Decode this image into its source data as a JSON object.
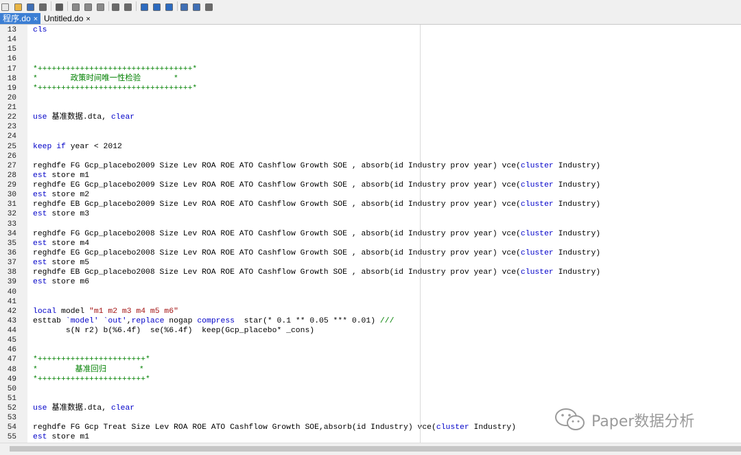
{
  "toolbar": {
    "icons": [
      "new-file-icon",
      "open-file-icon",
      "save-icon",
      "print-icon",
      "find-icon",
      "cut-icon",
      "copy-icon",
      "paste-icon",
      "undo-icon",
      "redo-icon",
      "indent-icon",
      "bookmark-up-icon",
      "bookmark-down-icon",
      "execute-icon",
      "run-icon",
      "more-icon"
    ]
  },
  "tabs": [
    {
      "label": "程序.do",
      "close": "×",
      "active": true
    },
    {
      "label": "Untitled.do",
      "close": "×",
      "active": false
    }
  ],
  "lines": [
    {
      "n": "13",
      "segs": [
        {
          "t": "cls",
          "c": "kw"
        }
      ]
    },
    {
      "n": "14",
      "segs": []
    },
    {
      "n": "15",
      "segs": []
    },
    {
      "n": "16",
      "segs": []
    },
    {
      "n": "17",
      "segs": [
        {
          "t": "*+++++++++++++++++++++++++++++++++*",
          "c": "cmt"
        }
      ]
    },
    {
      "n": "18",
      "segs": [
        {
          "t": "*       政策时间唯一性检验       *",
          "c": "cmt"
        }
      ]
    },
    {
      "n": "19",
      "segs": [
        {
          "t": "*+++++++++++++++++++++++++++++++++*",
          "c": "cmt"
        }
      ]
    },
    {
      "n": "20",
      "segs": []
    },
    {
      "n": "21",
      "segs": []
    },
    {
      "n": "22",
      "segs": [
        {
          "t": "use",
          "c": "kw"
        },
        {
          "t": " 基准数据.dta, "
        },
        {
          "t": "clear",
          "c": "kw"
        }
      ]
    },
    {
      "n": "23",
      "segs": []
    },
    {
      "n": "24",
      "segs": []
    },
    {
      "n": "25",
      "segs": [
        {
          "t": "keep",
          "c": "kw"
        },
        {
          "t": " "
        },
        {
          "t": "if",
          "c": "kw"
        },
        {
          "t": " year < 2012"
        }
      ]
    },
    {
      "n": "26",
      "segs": []
    },
    {
      "n": "27",
      "segs": [
        {
          "t": "reghdfe FG Gcp_placebo2009 Size Lev ROA ROE ATO Cashflow Growth SOE , absorb(id Industry prov year) vce("
        },
        {
          "t": "cluster",
          "c": "kw"
        },
        {
          "t": " Industry)"
        }
      ]
    },
    {
      "n": "28",
      "segs": [
        {
          "t": "est",
          "c": "kw"
        },
        {
          "t": " store m1"
        }
      ]
    },
    {
      "n": "29",
      "segs": [
        {
          "t": "reghdfe EG Gcp_placebo2009 Size Lev ROA ROE ATO Cashflow Growth SOE , absorb(id Industry prov year) vce("
        },
        {
          "t": "cluster",
          "c": "kw"
        },
        {
          "t": " Industry)"
        }
      ]
    },
    {
      "n": "30",
      "segs": [
        {
          "t": "est",
          "c": "kw"
        },
        {
          "t": " store m2"
        }
      ]
    },
    {
      "n": "31",
      "segs": [
        {
          "t": "reghdfe EB Gcp_placebo2009 Size Lev ROA ROE ATO Cashflow Growth SOE , absorb(id Industry prov year) vce("
        },
        {
          "t": "cluster",
          "c": "kw"
        },
        {
          "t": " Industry)"
        }
      ]
    },
    {
      "n": "32",
      "segs": [
        {
          "t": "est",
          "c": "kw"
        },
        {
          "t": " store m3"
        }
      ]
    },
    {
      "n": "33",
      "segs": []
    },
    {
      "n": "34",
      "segs": [
        {
          "t": "reghdfe FG Gcp_placebo2008 Size Lev ROA ROE ATO Cashflow Growth SOE , absorb(id Industry prov year) vce("
        },
        {
          "t": "cluster",
          "c": "kw"
        },
        {
          "t": " Industry)"
        }
      ]
    },
    {
      "n": "35",
      "segs": [
        {
          "t": "est",
          "c": "kw"
        },
        {
          "t": " store m4"
        }
      ]
    },
    {
      "n": "36",
      "segs": [
        {
          "t": "reghdfe EG Gcp_placebo2008 Size Lev ROA ROE ATO Cashflow Growth SOE , absorb(id Industry prov year) vce("
        },
        {
          "t": "cluster",
          "c": "kw"
        },
        {
          "t": " Industry)"
        }
      ]
    },
    {
      "n": "37",
      "segs": [
        {
          "t": "est",
          "c": "kw"
        },
        {
          "t": " store m5"
        }
      ]
    },
    {
      "n": "38",
      "segs": [
        {
          "t": "reghdfe EB Gcp_placebo2008 Size Lev ROA ROE ATO Cashflow Growth SOE , absorb(id Industry prov year) vce("
        },
        {
          "t": "cluster",
          "c": "kw"
        },
        {
          "t": " Industry)"
        }
      ]
    },
    {
      "n": "39",
      "segs": [
        {
          "t": "est",
          "c": "kw"
        },
        {
          "t": " store m6"
        }
      ]
    },
    {
      "n": "40",
      "segs": []
    },
    {
      "n": "41",
      "segs": []
    },
    {
      "n": "42",
      "segs": [
        {
          "t": "local",
          "c": "kw"
        },
        {
          "t": " model "
        },
        {
          "t": "\"m1 m2 m3 m4 m5 m6\"",
          "c": "str"
        }
      ]
    },
    {
      "n": "43",
      "segs": [
        {
          "t": "esttab "
        },
        {
          "t": "`model'",
          "c": "kw"
        },
        {
          "t": " "
        },
        {
          "t": "`out'",
          "c": "kw"
        },
        {
          "t": ","
        },
        {
          "t": "replace",
          "c": "kw"
        },
        {
          "t": " nogap "
        },
        {
          "t": "compress",
          "c": "kw"
        },
        {
          "t": "  star(* 0.1 ** 0.05 *** 0.01) "
        },
        {
          "t": "///",
          "c": "cmt"
        }
      ]
    },
    {
      "n": "44",
      "segs": [
        {
          "t": "       s(N r2) b(%6.4f)  se(%6.4f)  keep(Gcp_placebo* _cons)"
        }
      ]
    },
    {
      "n": "45",
      "segs": []
    },
    {
      "n": "46",
      "segs": []
    },
    {
      "n": "47",
      "segs": [
        {
          "t": "*+++++++++++++++++++++++*",
          "c": "cmt"
        }
      ]
    },
    {
      "n": "48",
      "segs": [
        {
          "t": "*        基准回归       *",
          "c": "cmt"
        }
      ]
    },
    {
      "n": "49",
      "segs": [
        {
          "t": "*+++++++++++++++++++++++*",
          "c": "cmt"
        }
      ]
    },
    {
      "n": "50",
      "segs": []
    },
    {
      "n": "51",
      "segs": []
    },
    {
      "n": "52",
      "segs": [
        {
          "t": "use",
          "c": "kw"
        },
        {
          "t": " 基准数据.dta, "
        },
        {
          "t": "clear",
          "c": "kw"
        }
      ]
    },
    {
      "n": "53",
      "segs": []
    },
    {
      "n": "54",
      "segs": [
        {
          "t": "reghdfe FG Gcp Treat Size Lev ROA ROE ATO Cashflow Growth SOE,absorb(id Industry) vce("
        },
        {
          "t": "cluster",
          "c": "kw"
        },
        {
          "t": " Industry)"
        }
      ]
    },
    {
      "n": "55",
      "segs": [
        {
          "t": "est",
          "c": "kw"
        },
        {
          "t": " store m1"
        }
      ]
    }
  ],
  "watermark": {
    "text": "Paper数据分析"
  },
  "colors": {
    "accent": "#3c7fd4",
    "comment": "#008000",
    "keyword": "#0000c8",
    "string": "#a31515"
  }
}
